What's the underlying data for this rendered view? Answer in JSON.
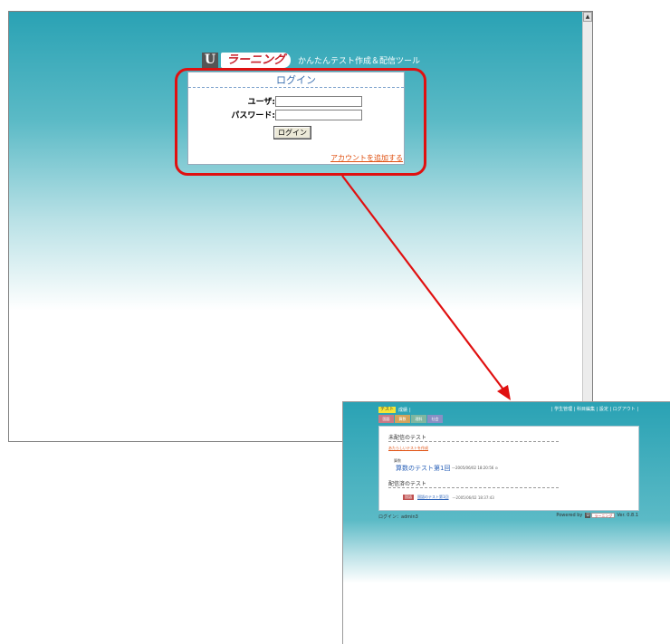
{
  "login_window": {
    "brand": {
      "logo_letter": "U",
      "logo_text": "ラーニング",
      "tagline": "かんたんテスト作成＆配信ツール"
    },
    "title": "ログイン",
    "user_label": "ユーザ:",
    "password_label": "パスワード:",
    "user_value": "",
    "password_value": "",
    "login_button": "ログイン",
    "add_account_link": "アカウントを追加する",
    "scroll_up_icon": "▲"
  },
  "app_window": {
    "tabs": [
      {
        "label": "テスト"
      },
      {
        "label": "成績"
      }
    ],
    "top_right_menu": "| 学生管理 | 科目編集 | 設定 | ログアウト |",
    "subject_tabs": [
      {
        "label": "国語",
        "color": "#c97a86"
      },
      {
        "label": "算数",
        "color": "#d3a35c"
      },
      {
        "label": "理科",
        "color": "#7fb6a0"
      },
      {
        "label": "社会",
        "color": "#8a8fc4"
      }
    ],
    "undelivered_title": "未配信のテスト",
    "new_test_link": "あたらしいテストを作成",
    "undelivered_test": {
      "category": "算数",
      "name": "算数のテスト第1回",
      "date": "—2005/06/02 18:20:56 ⊙"
    },
    "delivered_title": "配信済のテスト",
    "delivered_test": {
      "badge": "国語",
      "name": "国語のテスト第1回",
      "date": "—2005/06/02 18:37:43"
    },
    "footer_login": "ログイン：admin3",
    "footer_powered": "Powered by",
    "footer_logo_letter": "U",
    "footer_logo_text": "ラーニング",
    "footer_version": "Ver. 0.8.1"
  },
  "colors": {
    "highlight": "#e01010",
    "accent": "#2aa2b4",
    "link": "#e05010"
  }
}
